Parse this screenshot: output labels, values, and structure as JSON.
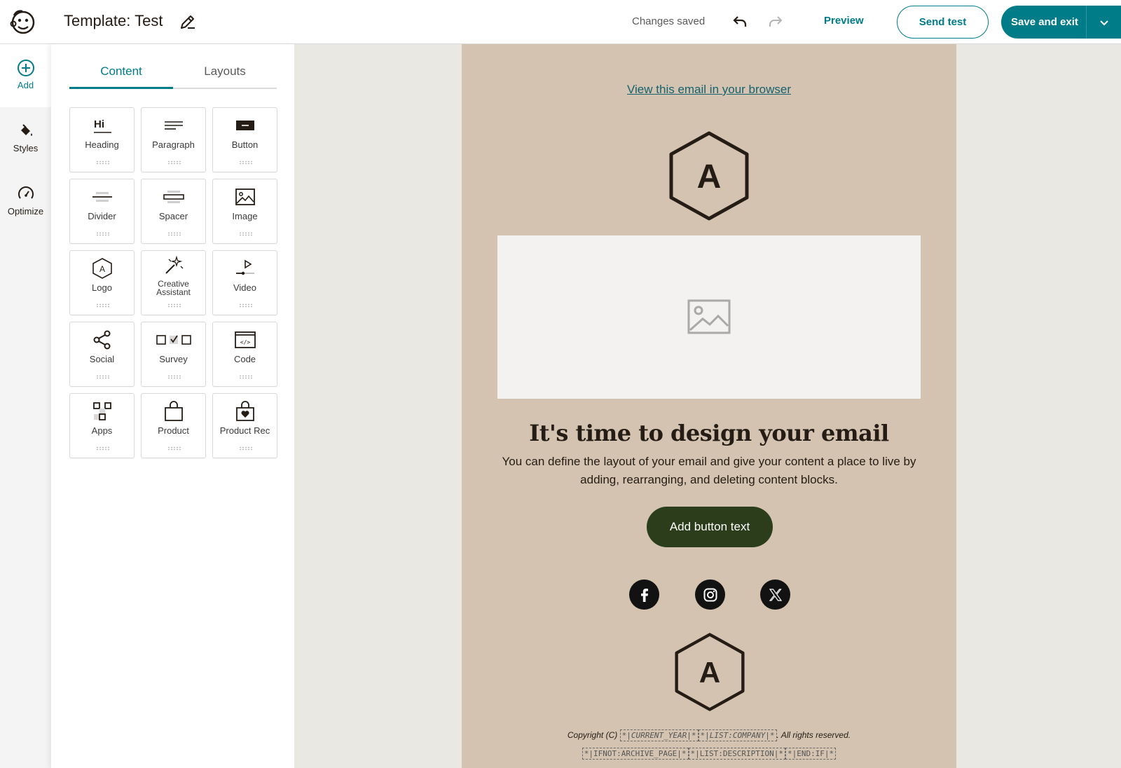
{
  "header": {
    "title": "Template: Test",
    "status": "Changes saved",
    "preview_label": "Preview",
    "send_test_label": "Send test",
    "save_exit_label": "Save and exit"
  },
  "rail": {
    "add_label": "Add",
    "styles_label": "Styles",
    "optimize_label": "Optimize"
  },
  "panel": {
    "tabs": [
      {
        "label": "Content",
        "active": true
      },
      {
        "label": "Layouts",
        "active": false
      }
    ],
    "blocks": [
      {
        "label": "Heading",
        "icon": "heading-icon"
      },
      {
        "label": "Paragraph",
        "icon": "paragraph-icon"
      },
      {
        "label": "Button",
        "icon": "button-icon"
      },
      {
        "label": "Divider",
        "icon": "divider-icon"
      },
      {
        "label": "Spacer",
        "icon": "spacer-icon"
      },
      {
        "label": "Image",
        "icon": "image-icon"
      },
      {
        "label": "Logo",
        "icon": "logo-icon"
      },
      {
        "label": "Creative Assistant",
        "icon": "magic-wand-icon"
      },
      {
        "label": "Video",
        "icon": "video-icon"
      },
      {
        "label": "Social",
        "icon": "share-icon"
      },
      {
        "label": "Survey",
        "icon": "survey-icon"
      },
      {
        "label": "Code",
        "icon": "code-icon"
      },
      {
        "label": "Apps",
        "icon": "apps-icon"
      },
      {
        "label": "Product",
        "icon": "bag-icon"
      },
      {
        "label": "Product Rec",
        "icon": "heart-bag-icon"
      }
    ]
  },
  "email": {
    "view_link": "View this email in your browser",
    "logo_letter": "A",
    "headline": "It's time to design your email",
    "body": "You can define the layout of your email and give your content a place to live by adding, rearranging, and deleting content blocks.",
    "cta_label": "Add button text",
    "social": [
      "facebook-icon",
      "instagram-icon",
      "x-icon"
    ],
    "copyright_prefix": "Copyright (C)",
    "merge_year": "*|CURRENT_YEAR|*",
    "merge_company": "*|LIST:COMPANY|*",
    "copyright_suffix": ". All rights reserved.",
    "merge_archive": "*|IFNOT:ARCHIVE_PAGE|*",
    "merge_description": "*|LIST:DESCRIPTION|*",
    "merge_endif": "*|END:IF|*"
  },
  "colors": {
    "accent": "#007c89",
    "canvas_bg": "#e9e8e2",
    "email_bg": "#d3c3b0",
    "cta_bg": "#2b3d1b"
  }
}
